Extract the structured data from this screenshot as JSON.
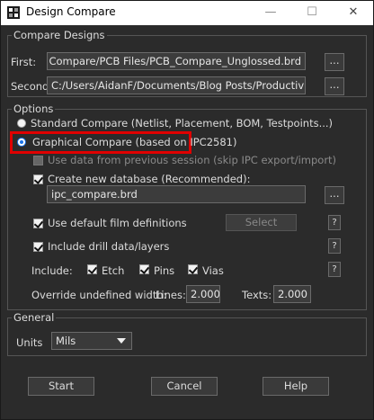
{
  "window": {
    "title": "Design Compare",
    "minimize_glyph": "—",
    "maximize_glyph": "☐",
    "close_glyph": "✕"
  },
  "compare_designs": {
    "legend": "Compare Designs",
    "first_label": "First:",
    "first_value": "C:/Users/AidanF/Documents/Blog Posts/Productivity Toolbox/PCB Compare/PCB Files/PCB_Compare_Unglossed.brd",
    "second_label": "Second:",
    "second_value": "C:/Users/AidanF/Documents/Blog Posts/Productivity Toolbox/PCB Compare/PCB Files/PCB_Compare_Glossed.brd",
    "browse_label": "..."
  },
  "options": {
    "legend": "Options",
    "standard_compare": "Standard Compare (Netlist, Placement, BOM, Testpoints...)",
    "graphical_compare": "Graphical Compare (based on IPC2581)",
    "use_previous_session": "Use data from previous session (skip IPC export/import)",
    "create_new_database": "Create new database (Recommended):",
    "database_value": "ipc_compare.brd",
    "browse_label": "...",
    "use_default_film": "Use default film definitions",
    "select_button": "Select",
    "help_glyph": "?",
    "include_drill": "Include drill data/layers",
    "include_label": "Include:",
    "etch": "Etch",
    "pins": "Pins",
    "vias": "Vias",
    "override_label": "Override undefined width:",
    "lines_label": "Lines:",
    "lines_value": "2.000",
    "texts_label": "Texts:",
    "texts_value": "2.000"
  },
  "general": {
    "legend": "General",
    "units_label": "Units",
    "units_value": "Mils"
  },
  "footer": {
    "start": "Start",
    "cancel": "Cancel",
    "help": "Help"
  },
  "colors": {
    "background": "#2b2b2b",
    "highlight": "#e00000",
    "radio_selected": "#1a73e8"
  }
}
